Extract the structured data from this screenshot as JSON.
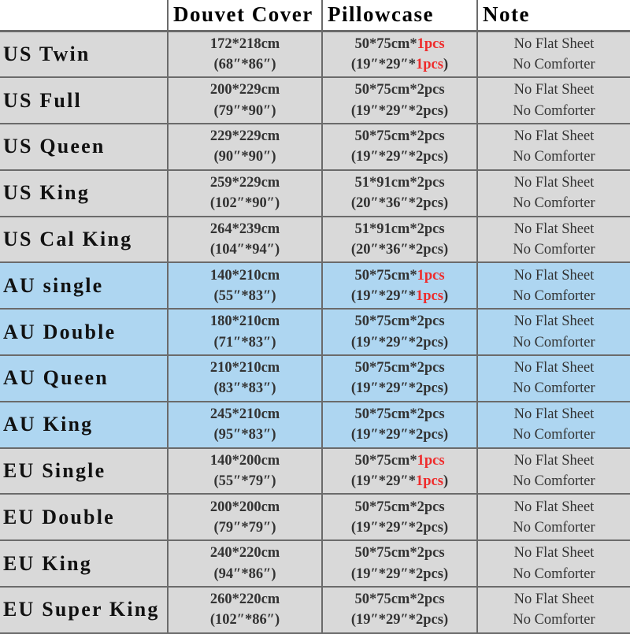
{
  "table": {
    "headers": {
      "name": "",
      "duvet": "Douvet Cover",
      "pillow": "Pillowcase",
      "note": "Note"
    },
    "highlight_color": "#ef2b2b",
    "row_bg_gray": "#d9d9d9",
    "row_bg_blue": "#aed6f1",
    "rows": [
      {
        "region": "US",
        "bg": "gray",
        "name": "US Twin",
        "duvet_cm": "172*218cm",
        "duvet_in": "(68″*86″)",
        "pillow_cm_prefix": "50*75cm*",
        "pillow_cm_count": "1pcs",
        "pillow_cm_highlight": true,
        "pillow_in_prefix": "(19″*29″*",
        "pillow_in_count": "1pcs",
        "pillow_in_suffix": ")",
        "note_line1": "No Flat Sheet",
        "note_line2": "No Comforter"
      },
      {
        "region": "US",
        "bg": "gray",
        "name": "US Full",
        "duvet_cm": "200*229cm",
        "duvet_in": "(79″*90″)",
        "pillow_cm_prefix": "50*75cm*",
        "pillow_cm_count": "2pcs",
        "pillow_cm_highlight": false,
        "pillow_in_prefix": "(19″*29″*",
        "pillow_in_count": "2pcs",
        "pillow_in_suffix": ")",
        "note_line1": "No Flat Sheet",
        "note_line2": "No Comforter"
      },
      {
        "region": "US",
        "bg": "gray",
        "name": "US Queen",
        "duvet_cm": "229*229cm",
        "duvet_in": "(90″*90″)",
        "pillow_cm_prefix": "50*75cm*",
        "pillow_cm_count": "2pcs",
        "pillow_cm_highlight": false,
        "pillow_in_prefix": "(19″*29″*",
        "pillow_in_count": "2pcs",
        "pillow_in_suffix": ")",
        "note_line1": "No Flat Sheet",
        "note_line2": "No Comforter"
      },
      {
        "region": "US",
        "bg": "gray",
        "name": "US King",
        "duvet_cm": "259*229cm",
        "duvet_in": "(102″*90″)",
        "pillow_cm_prefix": "51*91cm*",
        "pillow_cm_count": "2pcs",
        "pillow_cm_highlight": false,
        "pillow_in_prefix": "(20″*36″*",
        "pillow_in_count": "2pcs",
        "pillow_in_suffix": ")",
        "note_line1": "No Flat Sheet",
        "note_line2": "No Comforter"
      },
      {
        "region": "US",
        "bg": "gray",
        "name": "US Cal King",
        "duvet_cm": "264*239cm",
        "duvet_in": "(104″*94″)",
        "pillow_cm_prefix": "51*91cm*",
        "pillow_cm_count": "2pcs",
        "pillow_cm_highlight": false,
        "pillow_in_prefix": "(20″*36″*",
        "pillow_in_count": "2pcs",
        "pillow_in_suffix": ")",
        "note_line1": "No Flat Sheet",
        "note_line2": "No Comforter"
      },
      {
        "region": "AU",
        "bg": "blue",
        "name": "AU single",
        "duvet_cm": "140*210cm",
        "duvet_in": "(55″*83″)",
        "pillow_cm_prefix": "50*75cm*",
        "pillow_cm_count": "1pcs",
        "pillow_cm_highlight": true,
        "pillow_in_prefix": "(19″*29″*",
        "pillow_in_count": "1pcs",
        "pillow_in_suffix": ")",
        "note_line1": "No Flat Sheet",
        "note_line2": "No Comforter"
      },
      {
        "region": "AU",
        "bg": "blue",
        "name": "AU Double",
        "duvet_cm": "180*210cm",
        "duvet_in": "(71″*83″)",
        "pillow_cm_prefix": "50*75cm*",
        "pillow_cm_count": "2pcs",
        "pillow_cm_highlight": false,
        "pillow_in_prefix": "(19″*29″*",
        "pillow_in_count": "2pcs",
        "pillow_in_suffix": ")",
        "note_line1": "No Flat Sheet",
        "note_line2": "No Comforter"
      },
      {
        "region": "AU",
        "bg": "blue",
        "name": "AU Queen",
        "duvet_cm": "210*210cm",
        "duvet_in": "(83″*83″)",
        "pillow_cm_prefix": "50*75cm*",
        "pillow_cm_count": "2pcs",
        "pillow_cm_highlight": false,
        "pillow_in_prefix": "(19″*29″*",
        "pillow_in_count": "2pcs",
        "pillow_in_suffix": ")",
        "note_line1": "No Flat Sheet",
        "note_line2": "No Comforter"
      },
      {
        "region": "AU",
        "bg": "blue",
        "name": "AU King",
        "duvet_cm": "245*210cm",
        "duvet_in": "(95″*83″)",
        "pillow_cm_prefix": "50*75cm*",
        "pillow_cm_count": "2pcs",
        "pillow_cm_highlight": false,
        "pillow_in_prefix": "(19″*29″*",
        "pillow_in_count": "2pcs",
        "pillow_in_suffix": ")",
        "note_line1": "No Flat Sheet",
        "note_line2": "No Comforter"
      },
      {
        "region": "EU",
        "bg": "gray",
        "name": "EU Single",
        "duvet_cm": "140*200cm",
        "duvet_in": "(55″*79″)",
        "pillow_cm_prefix": "50*75cm*",
        "pillow_cm_count": "1pcs",
        "pillow_cm_highlight": true,
        "pillow_in_prefix": "(19″*29″*",
        "pillow_in_count": "1pcs",
        "pillow_in_suffix": ")",
        "note_line1": "No Flat Sheet",
        "note_line2": "No Comforter"
      },
      {
        "region": "EU",
        "bg": "gray",
        "name": "EU Double",
        "duvet_cm": "200*200cm",
        "duvet_in": "(79″*79″)",
        "pillow_cm_prefix": "50*75cm*",
        "pillow_cm_count": "2pcs",
        "pillow_cm_highlight": false,
        "pillow_in_prefix": "(19″*29″*",
        "pillow_in_count": "2pcs",
        "pillow_in_suffix": ")",
        "note_line1": "No Flat Sheet",
        "note_line2": "No Comforter"
      },
      {
        "region": "EU",
        "bg": "gray",
        "name": "EU King",
        "duvet_cm": "240*220cm",
        "duvet_in": "(94″*86″)",
        "pillow_cm_prefix": "50*75cm*",
        "pillow_cm_count": "2pcs",
        "pillow_cm_highlight": false,
        "pillow_in_prefix": "(19″*29″*",
        "pillow_in_count": "2pcs",
        "pillow_in_suffix": ")",
        "note_line1": "No Flat Sheet",
        "note_line2": "No Comforter"
      },
      {
        "region": "EU",
        "bg": "gray",
        "name": "EU Super King",
        "duvet_cm": "260*220cm",
        "duvet_in": "(102″*86″)",
        "pillow_cm_prefix": "50*75cm*",
        "pillow_cm_count": "2pcs",
        "pillow_cm_highlight": false,
        "pillow_in_prefix": "(19″*29″*",
        "pillow_in_count": "2pcs",
        "pillow_in_suffix": ")",
        "note_line1": "No Flat Sheet",
        "note_line2": "No Comforter"
      }
    ]
  }
}
